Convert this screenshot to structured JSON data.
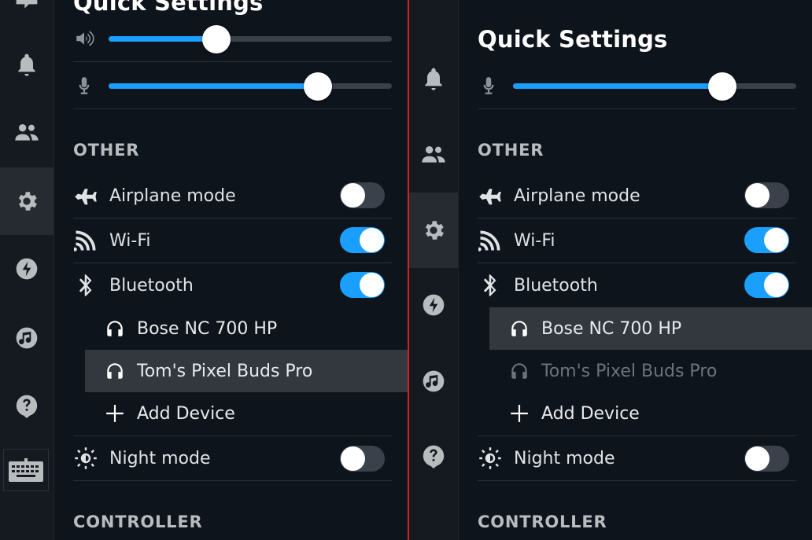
{
  "left": {
    "title": "Quick Settings",
    "sliders": {
      "volume": 0.38,
      "mic": 0.74
    },
    "section_other": "OTHER",
    "airplane_label": "Airplane mode",
    "wifi_label": "Wi-Fi",
    "bluetooth_label": "Bluetooth",
    "devices": [
      "Bose NC 700 HP",
      "Tom's Pixel Buds Pro"
    ],
    "add_device_label": "Add Device",
    "night_label": "Night mode",
    "section_controller": "CONTROLLER",
    "toggles": {
      "airplane": false,
      "wifi": true,
      "bluetooth": true,
      "night": false
    },
    "selected_device": "Tom's Pixel Buds Pro"
  },
  "right": {
    "title": "Quick Settings",
    "sliders": {
      "mic": 0.74
    },
    "section_other": "OTHER",
    "airplane_label": "Airplane mode",
    "wifi_label": "Wi-Fi",
    "bluetooth_label": "Bluetooth",
    "devices": [
      "Bose NC 700 HP",
      "Tom's Pixel Buds Pro"
    ],
    "add_device_label": "Add Device",
    "night_label": "Night mode",
    "section_controller": "CONTROLLER",
    "toggles": {
      "airplane": false,
      "wifi": true,
      "bluetooth": true,
      "night": false
    },
    "selected_device": "Bose NC 700 HP"
  },
  "colors": {
    "accent": "#1a9fff",
    "background": "#0e141b",
    "rail": "#151a21",
    "divider": "#d81f1f"
  },
  "icons": [
    "broadcast-icon",
    "bell-icon",
    "friends-icon",
    "gear-icon",
    "lightning-icon",
    "music-icon",
    "help-icon",
    "keyboard-icon",
    "volume-icon",
    "microphone-icon",
    "airplane-icon",
    "wifi-icon",
    "bluetooth-icon",
    "headphones-icon",
    "plus-icon",
    "night-mode-icon"
  ]
}
